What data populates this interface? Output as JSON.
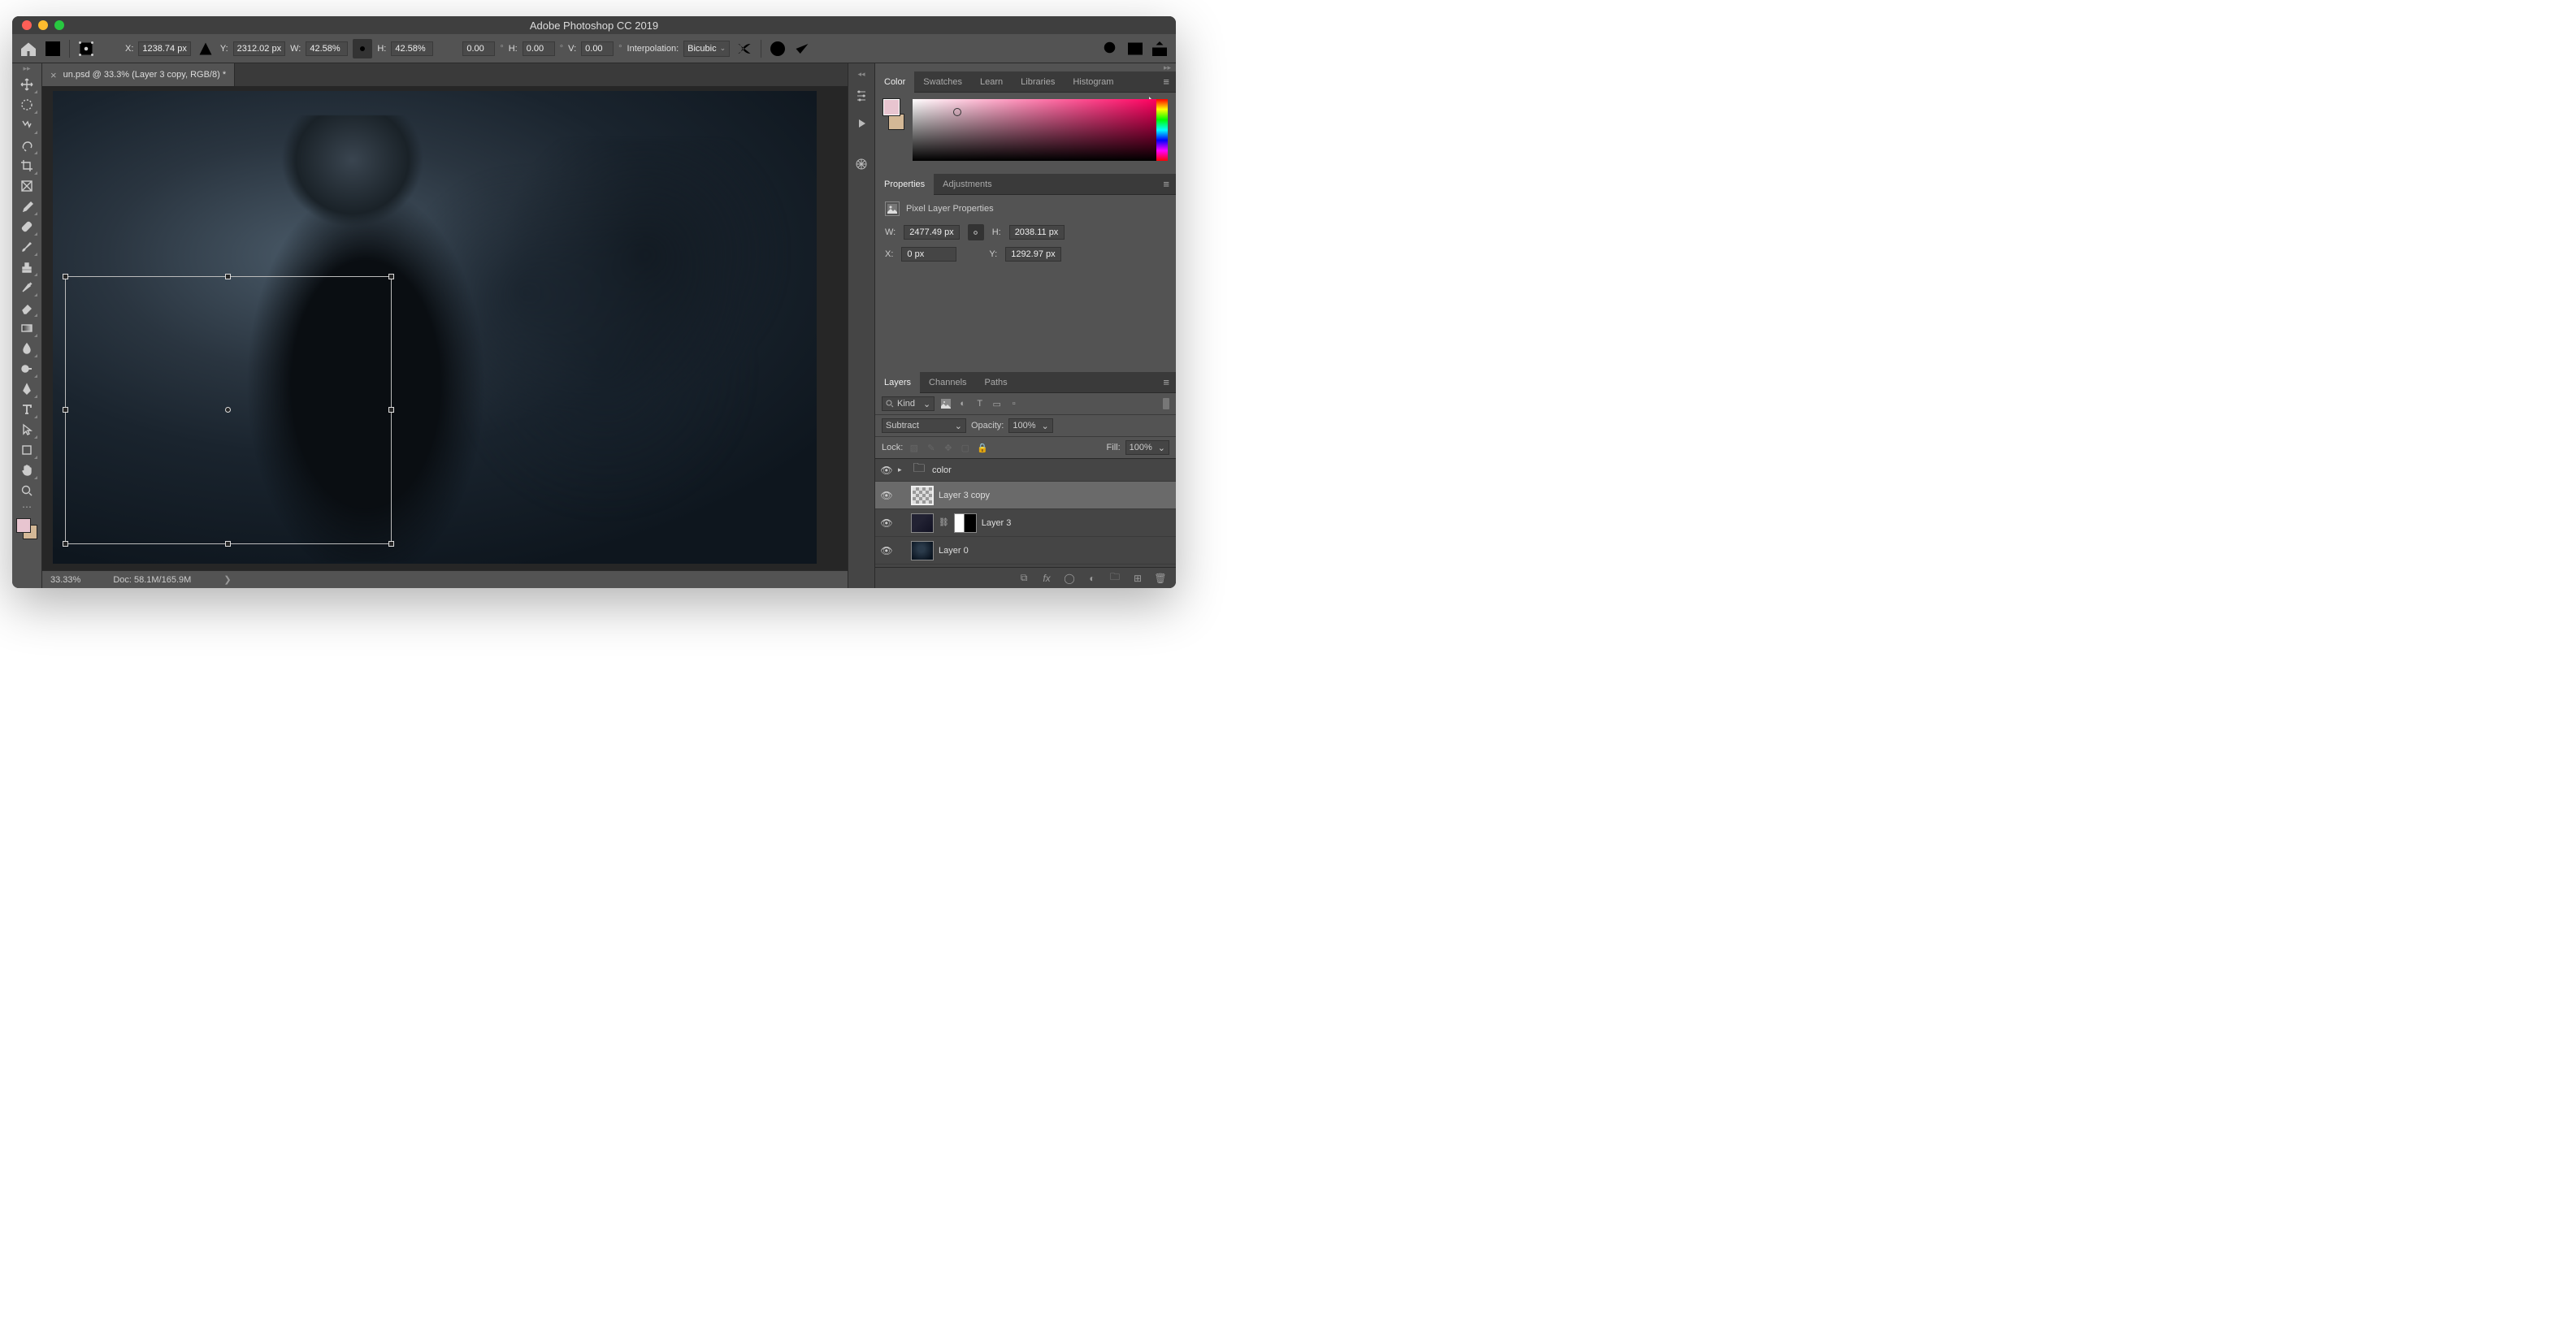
{
  "window": {
    "title": "Adobe Photoshop CC 2019"
  },
  "options": {
    "x": "1238.74 px",
    "y": "2312.02 px",
    "w": "42.58%",
    "h": "42.58%",
    "angle": "0.00",
    "hskew": "0.00",
    "vskew": "0.00",
    "interp_label": "Interpolation:",
    "interp_value": "Bicubic"
  },
  "tab": {
    "label": "un.psd @ 33.3% (Layer 3 copy, RGB/8) *"
  },
  "status": {
    "zoom": "33.33%",
    "doc": "Doc: 58.1M/165.9M"
  },
  "panels": {
    "color_tabs": [
      "Color",
      "Swatches",
      "Learn",
      "Libraries",
      "Histogram"
    ],
    "props_tabs": [
      "Properties",
      "Adjustments"
    ],
    "props_title": "Pixel Layer Properties",
    "props": {
      "w": "2477.49 px",
      "h": "2038.11 px",
      "x": "0 px",
      "y": "1292.97 px"
    },
    "layers_tabs": [
      "Layers",
      "Channels",
      "Paths"
    ],
    "filter_placeholder": "Kind",
    "blend": "Subtract",
    "opacity_label": "Opacity:",
    "opacity": "100%",
    "lock_label": "Lock:",
    "fill_label": "Fill:",
    "fill": "100%",
    "layers": [
      {
        "name": "color",
        "kind": "group"
      },
      {
        "name": "Layer 3 copy",
        "kind": "pixel",
        "selected": true
      },
      {
        "name": "Layer 3",
        "kind": "pixel",
        "mask": true
      },
      {
        "name": "Layer 0",
        "kind": "pixel"
      }
    ]
  }
}
